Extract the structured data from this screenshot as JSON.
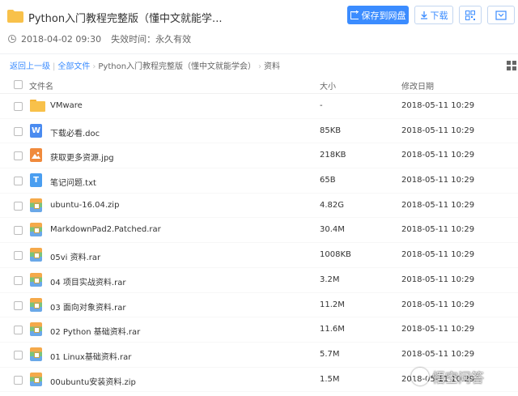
{
  "header": {
    "title": "Python入门教程完整版（懂中文就能学...",
    "date": "2018-04-02 09:30",
    "expiry": "失效时间：永久有效",
    "save_label": "保存到网盘",
    "download_label": "下载"
  },
  "breadcrumb": {
    "back": "返回上一级",
    "all": "全部文件",
    "path1": "Python入门教程完整版（懂中文就能学会）",
    "path2": "资料"
  },
  "table": {
    "headers": {
      "name": "文件名",
      "size": "大小",
      "time": "修改日期"
    },
    "rows": [
      {
        "icon": "folder-icon",
        "type": "folder",
        "name": "VMware",
        "size": "-",
        "time": "2018-05-11 10:29"
      },
      {
        "icon": "word-doc-icon",
        "type": "doc",
        "name": "下载必看.doc",
        "size": "85KB",
        "time": "2018-05-11 10:29"
      },
      {
        "icon": "image-file-icon",
        "type": "img",
        "name": "获取更多资源.jpg",
        "size": "218KB",
        "time": "2018-05-11 10:29"
      },
      {
        "icon": "text-file-icon",
        "type": "txt",
        "name": "笔记问题.txt",
        "size": "65B",
        "time": "2018-05-11 10:29"
      },
      {
        "icon": "archive-icon",
        "type": "zip",
        "name": "ubuntu-16.04.zip",
        "size": "4.82G",
        "time": "2018-05-11 10:29"
      },
      {
        "icon": "archive-icon",
        "type": "zip",
        "name": "MarkdownPad2.Patched.rar",
        "size": "30.4M",
        "time": "2018-05-11 10:29"
      },
      {
        "icon": "archive-icon",
        "type": "zip",
        "name": "05vi 资料.rar",
        "size": "1008KB",
        "time": "2018-05-11 10:29"
      },
      {
        "icon": "archive-icon",
        "type": "zip",
        "name": "04 项目实战资料.rar",
        "size": "3.2M",
        "time": "2018-05-11 10:29"
      },
      {
        "icon": "archive-icon",
        "type": "zip",
        "name": "03 面向对象资料.rar",
        "size": "11.2M",
        "time": "2018-05-11 10:29"
      },
      {
        "icon": "archive-icon",
        "type": "zip",
        "name": "02 Python 基础资料.rar",
        "size": "11.6M",
        "time": "2018-05-11 10:29"
      },
      {
        "icon": "archive-icon",
        "type": "zip",
        "name": "01 Linux基础资料.rar",
        "size": "5.7M",
        "time": "2018-05-11 10:29"
      },
      {
        "icon": "archive-icon",
        "type": "zip",
        "name": "00ubuntu安装资料.zip",
        "size": "1.5M",
        "time": "2018-05-11 10:29"
      }
    ]
  },
  "watermark": "悟空问答",
  "colors": {
    "accent": "#3b8cff",
    "folder": "#f8c14a",
    "doc": "#4a8bf0",
    "img": "#f08a3c"
  }
}
